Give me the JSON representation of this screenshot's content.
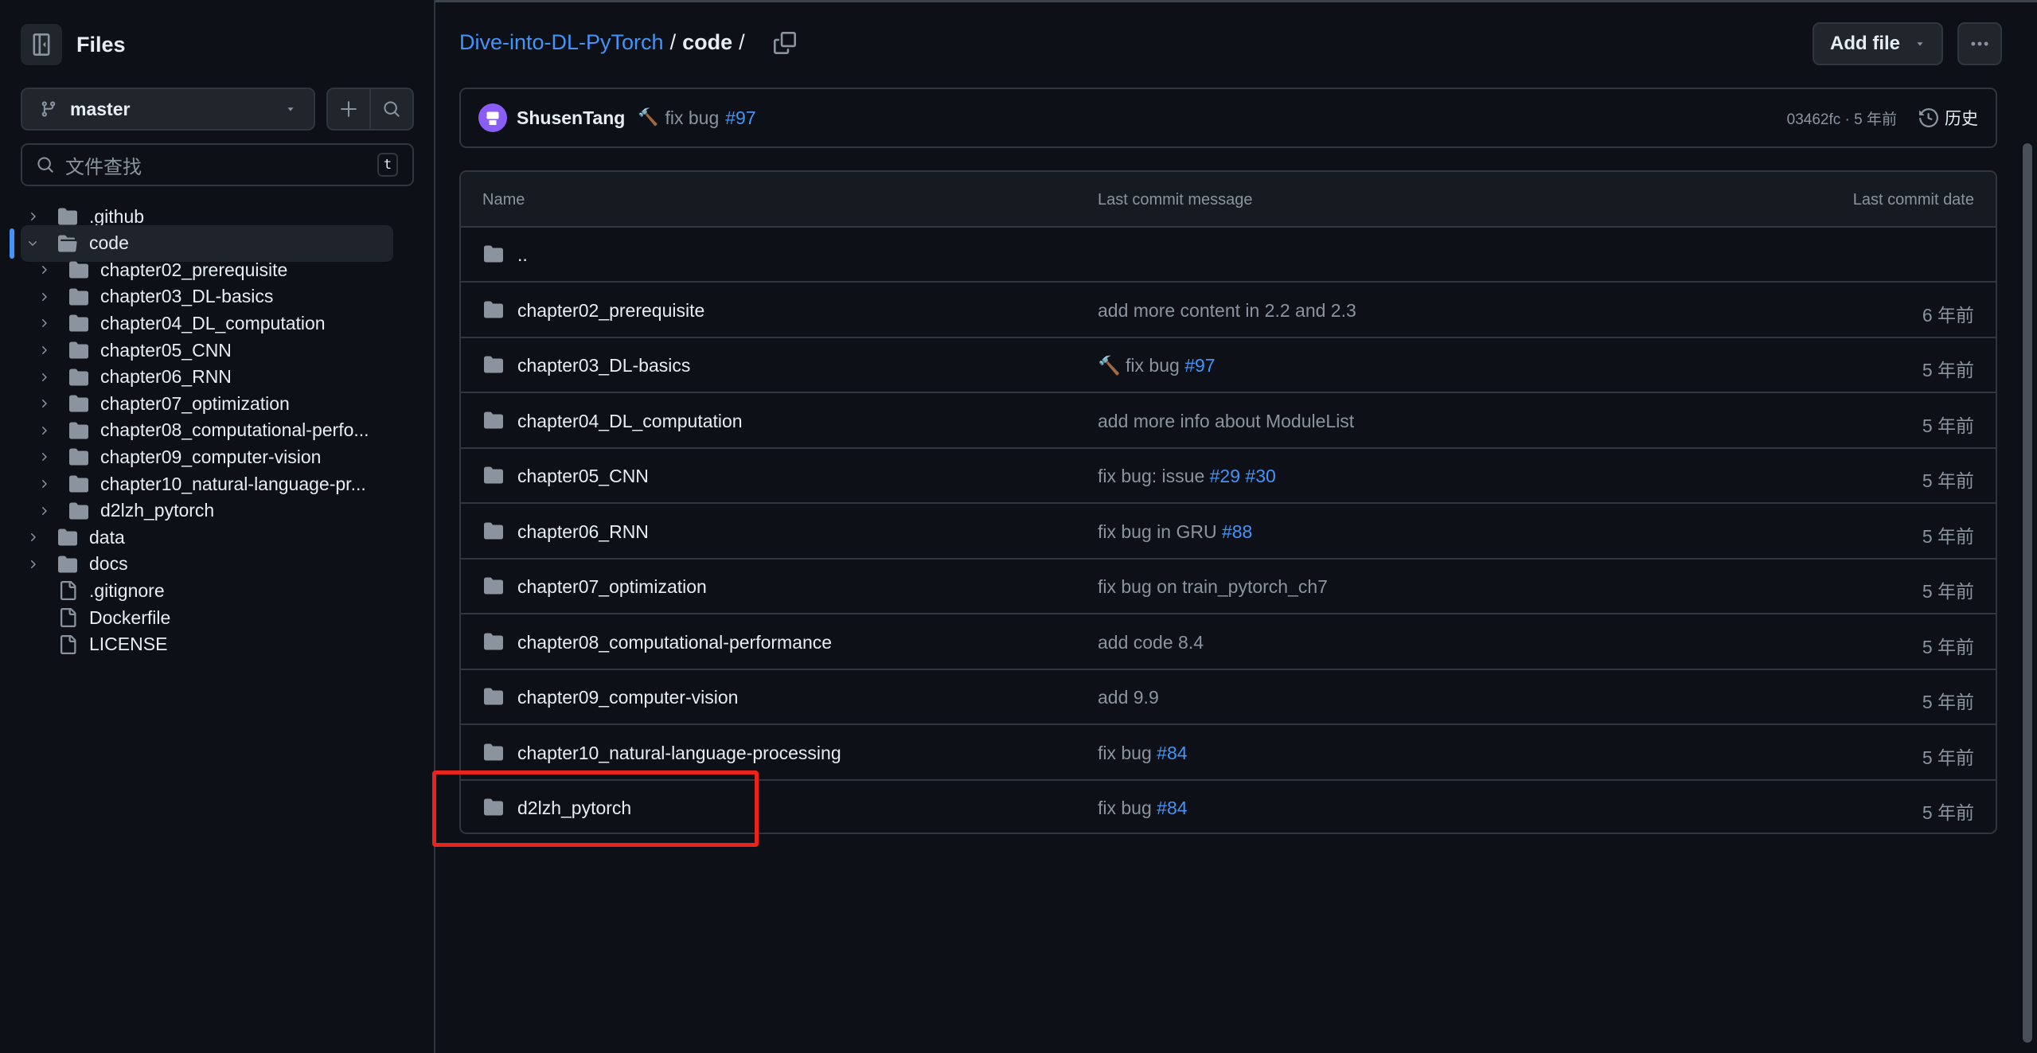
{
  "sidebar": {
    "title": "Files",
    "branch": "master",
    "search_placeholder": "文件查找",
    "search_shortcut": "t",
    "tree": [
      {
        "name": ".github",
        "type": "folder",
        "depth": 0,
        "expanded": false
      },
      {
        "name": "code",
        "type": "folder",
        "depth": 0,
        "expanded": true,
        "active": true
      },
      {
        "name": "chapter02_prerequisite",
        "type": "folder",
        "depth": 1,
        "expanded": false
      },
      {
        "name": "chapter03_DL-basics",
        "type": "folder",
        "depth": 1,
        "expanded": false
      },
      {
        "name": "chapter04_DL_computation",
        "type": "folder",
        "depth": 1,
        "expanded": false
      },
      {
        "name": "chapter05_CNN",
        "type": "folder",
        "depth": 1,
        "expanded": false
      },
      {
        "name": "chapter06_RNN",
        "type": "folder",
        "depth": 1,
        "expanded": false
      },
      {
        "name": "chapter07_optimization",
        "type": "folder",
        "depth": 1,
        "expanded": false
      },
      {
        "name": "chapter08_computational-perfo...",
        "type": "folder",
        "depth": 1,
        "expanded": false
      },
      {
        "name": "chapter09_computer-vision",
        "type": "folder",
        "depth": 1,
        "expanded": false
      },
      {
        "name": "chapter10_natural-language-pr...",
        "type": "folder",
        "depth": 1,
        "expanded": false
      },
      {
        "name": "d2lzh_pytorch",
        "type": "folder",
        "depth": 1,
        "expanded": false
      },
      {
        "name": "data",
        "type": "folder",
        "depth": 0,
        "expanded": false
      },
      {
        "name": "docs",
        "type": "folder",
        "depth": 0,
        "expanded": false
      },
      {
        "name": ".gitignore",
        "type": "file",
        "depth": 0
      },
      {
        "name": "Dockerfile",
        "type": "file",
        "depth": 0
      },
      {
        "name": "LICENSE",
        "type": "file",
        "depth": 0
      }
    ]
  },
  "breadcrumb": {
    "repo": "Dive-into-DL-PyTorch",
    "sep1": "/",
    "current": "code",
    "sep2": "/"
  },
  "toolbar": {
    "add_file_label": "Add file"
  },
  "latest_commit": {
    "author": "ShusenTang",
    "message": "fix bug",
    "ref": "#97",
    "hash_age": "03462fc · 5 年前",
    "history_label": "历史"
  },
  "table": {
    "headers": [
      "Name",
      "Last commit message",
      "Last commit date"
    ],
    "parent_label": "..",
    "rows": [
      {
        "name": "chapter02_prerequisite",
        "msg": "add more content in 2.2 and 2.3",
        "refs": [],
        "date": "6 年前"
      },
      {
        "name": "chapter03_DL-basics",
        "msg": "fix bug",
        "hammer": true,
        "refs": [
          "#97"
        ],
        "date": "5 年前"
      },
      {
        "name": "chapter04_DL_computation",
        "msg": "add more info about ModuleList",
        "refs": [],
        "date": "5 年前"
      },
      {
        "name": "chapter05_CNN",
        "msg": "fix bug: issue",
        "refs": [
          "#29",
          "#30"
        ],
        "date": "5 年前"
      },
      {
        "name": "chapter06_RNN",
        "msg": "fix bug in GRU",
        "refs": [
          "#88"
        ],
        "date": "5 年前"
      },
      {
        "name": "chapter07_optimization",
        "msg": "fix bug on train_pytorch_ch7",
        "refs": [],
        "date": "5 年前"
      },
      {
        "name": "chapter08_computational-performance",
        "msg": "add code 8.4",
        "refs": [],
        "date": "5 年前"
      },
      {
        "name": "chapter09_computer-vision",
        "msg": "add 9.9",
        "refs": [],
        "date": "5 年前"
      },
      {
        "name": "chapter10_natural-language-processing",
        "msg": "fix bug",
        "refs": [
          "#84"
        ],
        "date": "5 年前"
      },
      {
        "name": "d2lzh_pytorch",
        "msg": "fix bug",
        "refs": [
          "#84"
        ],
        "date": "5 年前"
      }
    ]
  },
  "colors": {
    "background": "#0d1117",
    "accent_link": "#4493f8",
    "highlight_box": "#e8241c",
    "muted_text": "#8b949e"
  }
}
